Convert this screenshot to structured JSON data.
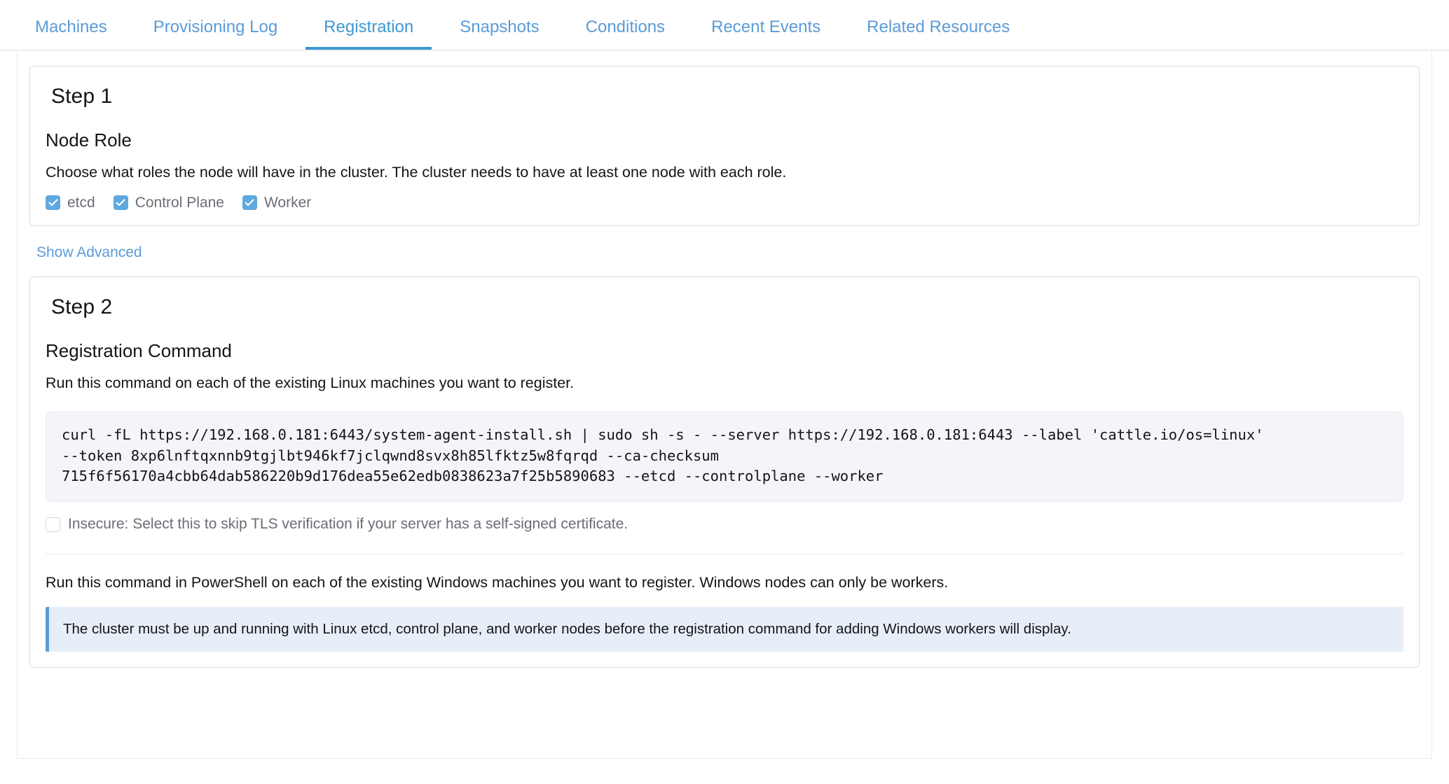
{
  "tabs": [
    {
      "label": "Machines",
      "active": false
    },
    {
      "label": "Provisioning Log",
      "active": false
    },
    {
      "label": "Registration",
      "active": true
    },
    {
      "label": "Snapshots",
      "active": false
    },
    {
      "label": "Conditions",
      "active": false
    },
    {
      "label": "Recent Events",
      "active": false
    },
    {
      "label": "Related Resources",
      "active": false
    }
  ],
  "step1": {
    "title": "Step 1",
    "section_heading": "Node Role",
    "description": "Choose what roles the node will have in the cluster. The cluster needs to have at least one node with each role.",
    "roles": [
      {
        "label": "etcd",
        "checked": true
      },
      {
        "label": "Control Plane",
        "checked": true
      },
      {
        "label": "Worker",
        "checked": true
      }
    ]
  },
  "show_advanced": {
    "label": "Show Advanced"
  },
  "step2": {
    "title": "Step 2",
    "section_heading": "Registration Command",
    "linux_description": "Run this command on each of the existing Linux machines you want to register.",
    "command": "curl -fL https://192.168.0.181:6443/system-agent-install.sh | sudo sh -s - --server https://192.168.0.181:6443 --label 'cattle.io/os=linux'\n--token 8xp6lnftqxnnb9tgjlbt946kf7jclqwnd8svx8h85lfktz5w8fqrqd --ca-checksum\n715f6f56170a4cbb64dab586220b9d176dea55e62edb0838623a7f25b5890683 --etcd --controlplane --worker",
    "insecure": {
      "label": "Insecure: Select this to skip TLS verification if your server has a self-signed certificate.",
      "checked": false
    },
    "windows_description": "Run this command in PowerShell on each of the existing Windows machines you want to register. Windows nodes can only be workers.",
    "banner_text": "The cluster must be up and running with Linux etcd, control plane, and worker nodes before the registration command for adding Windows workers will display."
  },
  "colors": {
    "link": "#5b9bd8",
    "active_tab": "#3d98d3",
    "checkbox_fill": "#5fa8e0",
    "banner_bg": "#e7eef8",
    "banner_accent": "#5b9bd8",
    "code_bg": "#f4f5f9"
  }
}
